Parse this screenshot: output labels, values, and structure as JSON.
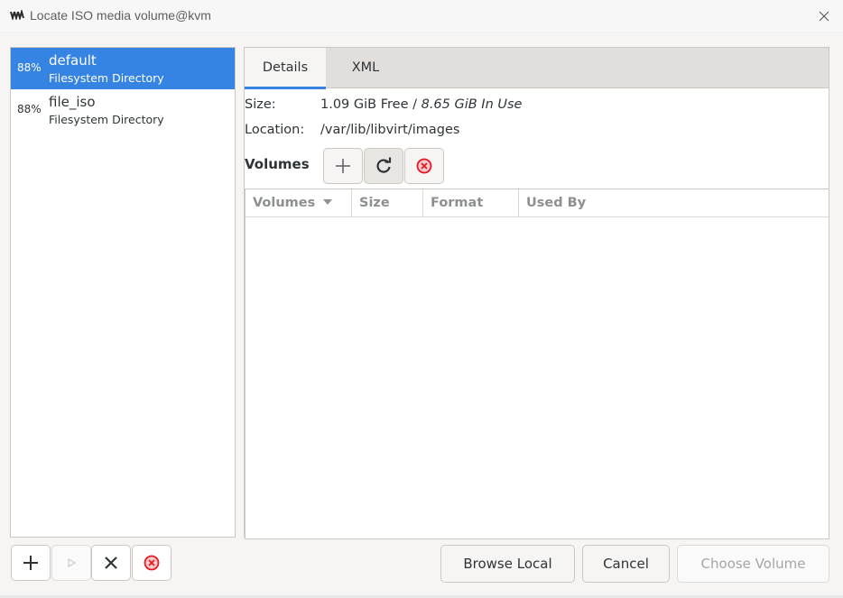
{
  "window": {
    "title": "Locate ISO media volume@kvm",
    "icon": "virt-manager-icon",
    "close_icon": "close-icon"
  },
  "pools": [
    {
      "percent": "88%",
      "name": "default",
      "type": "Filesystem Directory",
      "selected": true
    },
    {
      "percent": "88%",
      "name": "file_iso",
      "type": "Filesystem Directory",
      "selected": false
    }
  ],
  "tabs": [
    {
      "label": "Details",
      "active": true
    },
    {
      "label": "XML",
      "active": false
    }
  ],
  "details": {
    "size_label": "Size:",
    "size_free": "1.09 GiB Free / ",
    "size_in_use": "8.65 GiB In Use",
    "location_label": "Location:",
    "location_value": "/var/lib/libvirt/images",
    "volumes_label": "Volumes"
  },
  "volume_toolbar": [
    {
      "icon": "add-icon"
    },
    {
      "icon": "refresh-icon"
    },
    {
      "icon": "delete-icon"
    }
  ],
  "volume_table": {
    "columns": [
      "Volumes",
      "Size",
      "Format",
      "Used By"
    ],
    "sort_icon": "sort-descending-icon",
    "rows": []
  },
  "pool_toolbar": [
    {
      "icon": "add-icon",
      "enabled": true
    },
    {
      "icon": "play-icon",
      "enabled": false
    },
    {
      "icon": "stop-icon",
      "enabled": true
    },
    {
      "icon": "delete-icon",
      "enabled": true
    }
  ],
  "actions": {
    "browse_local": "Browse Local",
    "cancel": "Cancel",
    "choose_volume": "Choose Volume"
  },
  "colors": {
    "accent": "#3584e4",
    "delete_red": "#e01b24"
  }
}
